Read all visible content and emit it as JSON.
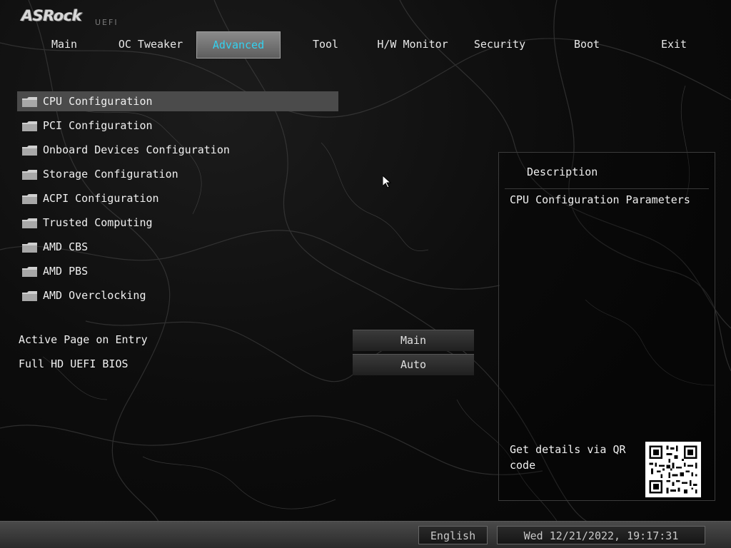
{
  "logo": {
    "brand": "ASRock",
    "sub": "UEFI"
  },
  "tabs": [
    {
      "label": "Main",
      "active": false
    },
    {
      "label": "OC Tweaker",
      "active": false
    },
    {
      "label": "Advanced",
      "active": true
    },
    {
      "label": "Tool",
      "active": false
    },
    {
      "label": "H/W Monitor",
      "active": false
    },
    {
      "label": "Security",
      "active": false
    },
    {
      "label": "Boot",
      "active": false
    },
    {
      "label": "Exit",
      "active": false
    }
  ],
  "menu": {
    "items": [
      {
        "label": "CPU Configuration",
        "icon": "folder-icon",
        "selected": true
      },
      {
        "label": "PCI Configuration",
        "icon": "folder-icon"
      },
      {
        "label": "Onboard Devices Configuration",
        "icon": "folder-icon"
      },
      {
        "label": "Storage Configuration",
        "icon": "folder-icon"
      },
      {
        "label": "ACPI Configuration",
        "icon": "folder-icon"
      },
      {
        "label": "Trusted Computing",
        "icon": "folder-icon"
      },
      {
        "label": "AMD CBS",
        "icon": "folder-icon"
      },
      {
        "label": "AMD PBS",
        "icon": "folder-icon"
      },
      {
        "label": "AMD Overclocking",
        "icon": "folder-icon"
      }
    ]
  },
  "settings": [
    {
      "label": "Active Page on Entry",
      "value": "Main"
    },
    {
      "label": "Full HD UEFI BIOS",
      "value": "Auto"
    }
  ],
  "description": {
    "title": "Description",
    "text": "CPU Configuration Parameters",
    "qr_text": "Get details via QR code"
  },
  "footer": {
    "language": "English",
    "datetime": "Wed 12/21/2022, 19:17:31"
  },
  "colors": {
    "active_tab_text": "#34d1ef",
    "selected_row": "#4b4b4b"
  }
}
